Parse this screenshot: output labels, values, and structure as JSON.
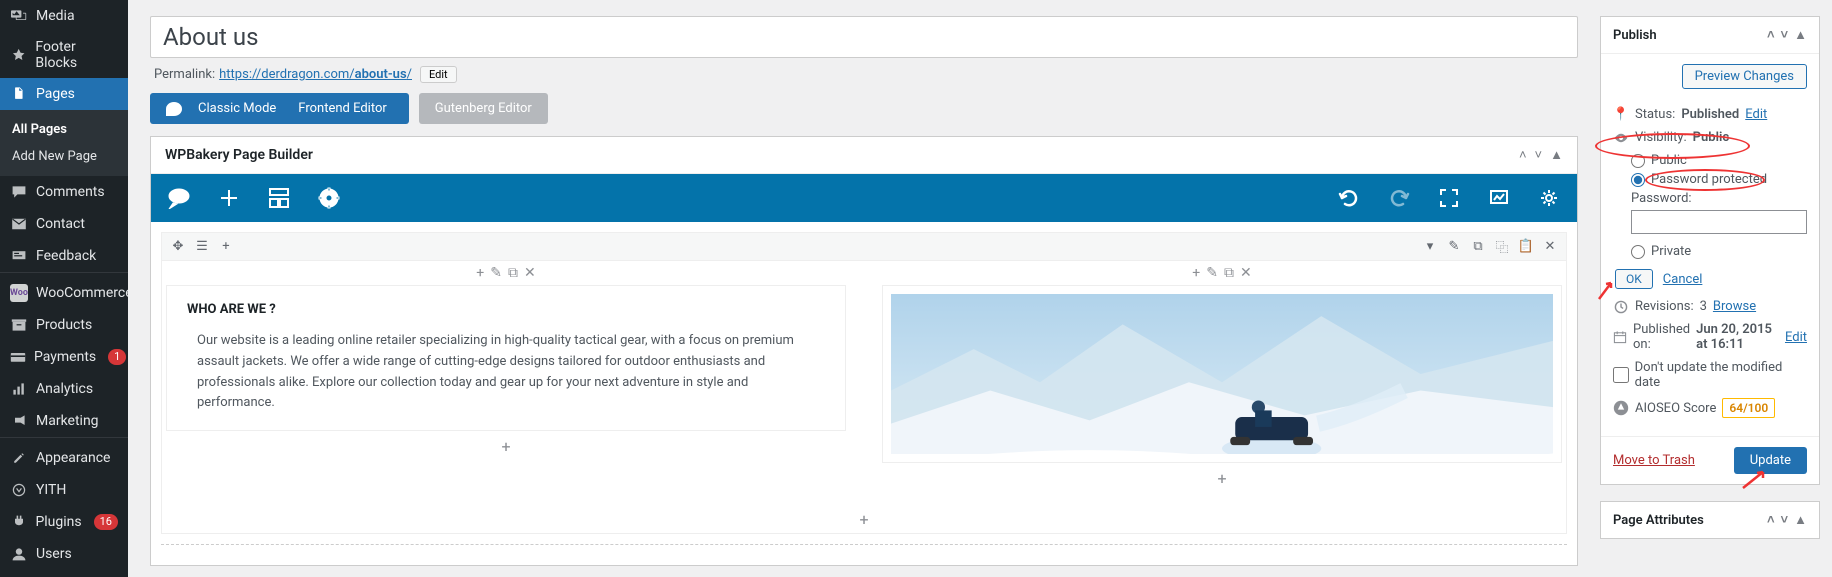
{
  "sidebar": {
    "items": [
      {
        "label": "Media",
        "icon": "media"
      },
      {
        "label": "Footer Blocks",
        "icon": "pin"
      },
      {
        "label": "Pages",
        "icon": "page",
        "active": true,
        "sub": [
          {
            "label": "All Pages",
            "active": true
          },
          {
            "label": "Add New Page"
          }
        ]
      },
      {
        "label": "Comments",
        "icon": "comment"
      },
      {
        "label": "Contact",
        "icon": "mail"
      },
      {
        "label": "Feedback",
        "icon": "feedback"
      },
      {
        "label": "WooCommerce",
        "icon": "woo"
      },
      {
        "label": "Products",
        "icon": "archive"
      },
      {
        "label": "Payments",
        "icon": "card",
        "badge": "1"
      },
      {
        "label": "Analytics",
        "icon": "analytics"
      },
      {
        "label": "Marketing",
        "icon": "megaphone"
      },
      {
        "label": "Appearance",
        "icon": "brush"
      },
      {
        "label": "YITH",
        "icon": "yith"
      },
      {
        "label": "Plugins",
        "icon": "plug",
        "badge": "16"
      },
      {
        "label": "Users",
        "icon": "user"
      }
    ]
  },
  "page": {
    "title": "About us",
    "permalink_label": "Permalink:",
    "permalink_url_base": "https://derdragon.com/",
    "permalink_slug": "about-us",
    "permalink_edit": "Edit"
  },
  "editors": {
    "classic": "Classic Mode",
    "frontend": "Frontend Editor",
    "gutenberg": "Gutenberg Editor"
  },
  "wpb": {
    "title": "WPBakery Page Builder",
    "content": {
      "heading": "WHO ARE WE ?",
      "body": "Our website is a leading online retailer specializing in high-quality tactical gear, with a focus on premium assault jackets. We offer a wide range of cutting-edge designs tailored for outdoor enthusiasts and professionals alike. Explore our collection today and gear up for your next adventure in style and performance."
    }
  },
  "publish": {
    "title": "Publish",
    "preview": "Preview Changes",
    "status_label": "Status:",
    "status_value": "Published",
    "status_edit": "Edit",
    "visibility_label": "Visibility:",
    "visibility_value": "Public",
    "vis_public": "Public",
    "vis_protected": "Password protected",
    "vis_private": "Private",
    "password_label": "Password:",
    "ok": "OK",
    "cancel": "Cancel",
    "revisions_label": "Revisions:",
    "revisions_count": "3",
    "revisions_browse": "Browse",
    "published_label": "Published on:",
    "published_value": "Jun 20, 2015 at 16:11",
    "published_edit": "Edit",
    "dont_update": "Don't update the modified date",
    "aioseo_label": "AIOSEO Score",
    "aioseo_score": "64/100",
    "trash": "Move to Trash",
    "update": "Update"
  },
  "attributes": {
    "title": "Page Attributes"
  }
}
